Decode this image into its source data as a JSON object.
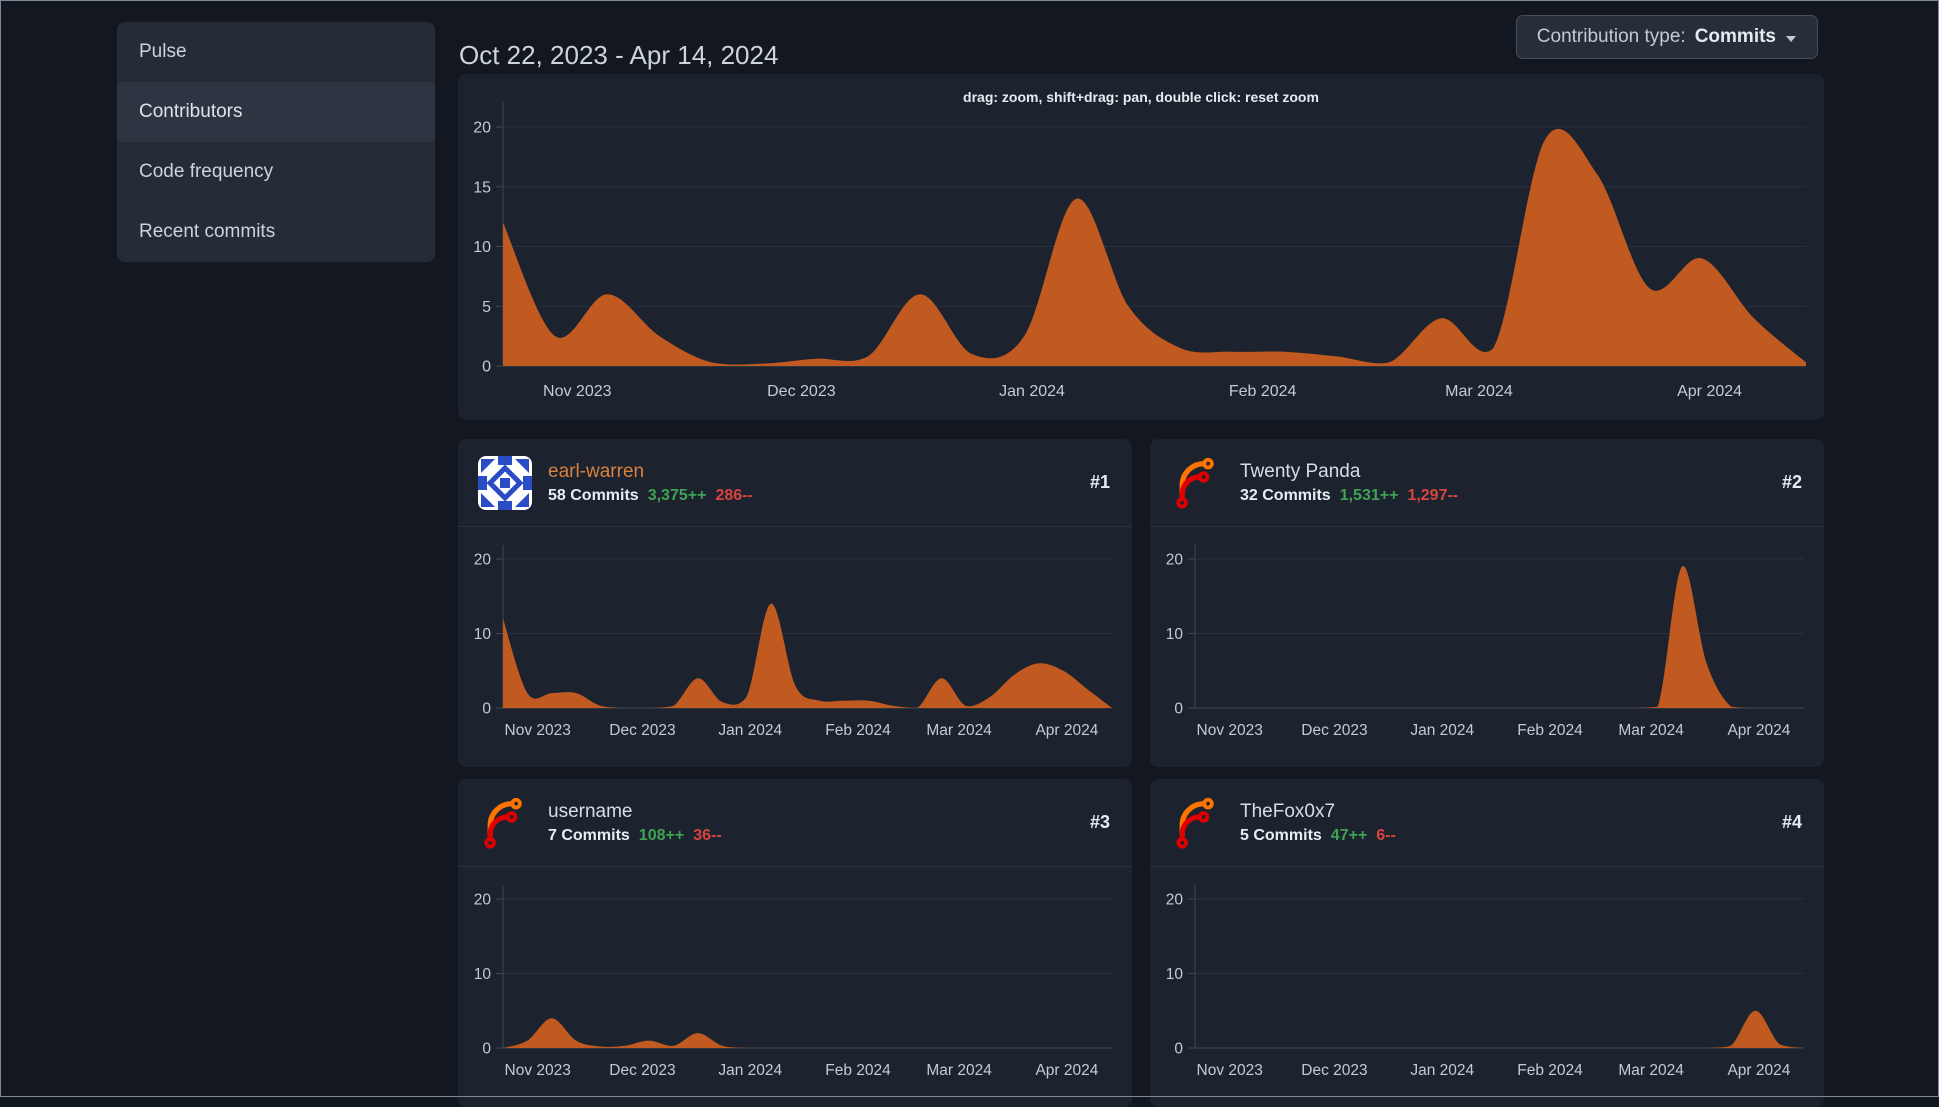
{
  "sidebar": {
    "items": [
      {
        "label": "Pulse",
        "active": false
      },
      {
        "label": "Contributors",
        "active": true
      },
      {
        "label": "Code frequency",
        "active": false
      },
      {
        "label": "Recent commits",
        "active": false
      }
    ]
  },
  "header": {
    "date_range": "Oct 22, 2023 - Apr 14, 2024",
    "contribution_type": {
      "label": "Contribution type:",
      "value": "Commits"
    }
  },
  "colors": {
    "area_orange": "#c05a20",
    "link_orange": "#d9813d",
    "additions_green": "#3fa255",
    "deletions_red": "#d8453f",
    "panel_background": "#1c232e",
    "page_background": "#13171f"
  },
  "contributors": [
    {
      "name": "earl-warren",
      "commits": "58 Commits",
      "additions": "3,375++",
      "deletions": "286--",
      "rank": "#1",
      "avatar": "identicon",
      "name_color": "orange"
    },
    {
      "name": "Twenty Panda",
      "commits": "32 Commits",
      "additions": "1,531++",
      "deletions": "1,297--",
      "rank": "#2",
      "avatar": "forgejo-logo",
      "name_color": "default"
    },
    {
      "name": "username",
      "commits": "7 Commits",
      "additions": "108++",
      "deletions": "36--",
      "rank": "#3",
      "avatar": "forgejo-logo",
      "name_color": "default"
    },
    {
      "name": "TheFox0x7",
      "commits": "5 Commits",
      "additions": "47++",
      "deletions": "6--",
      "rank": "#4",
      "avatar": "forgejo-logo",
      "name_color": "default"
    }
  ],
  "chart_data": [
    {
      "type": "area",
      "name": "all-contributions-weekly-commits",
      "hint": "drag: zoom, shift+drag: pan, double click: reset zoom",
      "x_range": [
        "Oct 22, 2023",
        "Apr 14, 2024"
      ],
      "interval": "weekly",
      "values": [
        12,
        2.5,
        6,
        2.5,
        0.3,
        0.2,
        0.6,
        0.8,
        6,
        1,
        2.5,
        14,
        5,
        1.5,
        1.2,
        1.2,
        0.8,
        0.3,
        4,
        1.5,
        19,
        16,
        6.5,
        9,
        4,
        0.3
      ],
      "ylim": [
        0,
        20
      ],
      "yticks": [
        0,
        5,
        10,
        15,
        20
      ],
      "xlabels": [
        "Nov 2023",
        "Dec 2023",
        "Jan 2024",
        "Feb 2024",
        "Mar 2024",
        "Apr 2024"
      ],
      "xlabel_fractions": [
        0.057,
        0.229,
        0.406,
        0.583,
        0.749,
        0.926
      ],
      "color": "#c05a20"
    },
    {
      "type": "area",
      "name": "earl-warren-weekly-commits",
      "x_range": [
        "Oct 22, 2023",
        "Apr 14, 2024"
      ],
      "interval": "weekly",
      "values": [
        12,
        2,
        2,
        2,
        0.3,
        0,
        0,
        0.3,
        4,
        0.8,
        1.5,
        14,
        3,
        1,
        1,
        1,
        0.3,
        0,
        4,
        0.3,
        1.5,
        4.5,
        6,
        5,
        2.5,
        0
      ],
      "ylim": [
        0,
        20
      ],
      "yticks": [
        0,
        10,
        20
      ],
      "xlabels": [
        "Nov 2023",
        "Dec 2023",
        "Jan 2024",
        "Feb 2024",
        "Mar 2024",
        "Apr 2024"
      ],
      "xlabel_fractions": [
        0.057,
        0.229,
        0.406,
        0.583,
        0.749,
        0.926
      ],
      "color": "#c05a20"
    },
    {
      "type": "area",
      "name": "twenty-panda-weekly-commits",
      "x_range": [
        "Oct 22, 2023",
        "Apr 14, 2024"
      ],
      "interval": "weekly",
      "values": [
        0,
        0,
        0,
        0,
        0,
        0,
        0,
        0,
        0,
        0,
        0,
        0,
        0,
        0,
        0,
        0,
        0,
        0,
        0,
        0.2,
        19,
        6,
        0.2,
        0,
        0,
        0
      ],
      "ylim": [
        0,
        20
      ],
      "yticks": [
        0,
        10,
        20
      ],
      "xlabels": [
        "Nov 2023",
        "Dec 2023",
        "Jan 2024",
        "Feb 2024",
        "Mar 2024",
        "Apr 2024"
      ],
      "xlabel_fractions": [
        0.057,
        0.229,
        0.406,
        0.583,
        0.749,
        0.926
      ],
      "color": "#c05a20"
    },
    {
      "type": "area",
      "name": "username-weekly-commits",
      "x_range": [
        "Oct 22, 2023",
        "Apr 14, 2024"
      ],
      "interval": "weekly",
      "values": [
        0,
        1,
        4,
        1,
        0.2,
        0.3,
        1,
        0.3,
        2,
        0.3,
        0,
        0,
        0,
        0,
        0,
        0,
        0,
        0,
        0,
        0,
        0,
        0,
        0,
        0,
        0,
        0
      ],
      "ylim": [
        0,
        20
      ],
      "yticks": [
        0,
        10,
        20
      ],
      "xlabels": [
        "Nov 2023",
        "Dec 2023",
        "Jan 2024",
        "Feb 2024",
        "Mar 2024",
        "Apr 2024"
      ],
      "xlabel_fractions": [
        0.057,
        0.229,
        0.406,
        0.583,
        0.749,
        0.926
      ],
      "color": "#c05a20"
    },
    {
      "type": "area",
      "name": "thefox0x7-weekly-commits",
      "x_range": [
        "Oct 22, 2023",
        "Apr 14, 2024"
      ],
      "interval": "weekly",
      "values": [
        0,
        0,
        0,
        0,
        0,
        0,
        0,
        0,
        0,
        0,
        0,
        0,
        0,
        0,
        0,
        0,
        0,
        0,
        0,
        0,
        0,
        0,
        0.3,
        5,
        0.5,
        0
      ],
      "ylim": [
        0,
        20
      ],
      "yticks": [
        0,
        10,
        20
      ],
      "xlabels": [
        "Nov 2023",
        "Dec 2023",
        "Jan 2024",
        "Feb 2024",
        "Mar 2024",
        "Apr 2024"
      ],
      "xlabel_fractions": [
        0.057,
        0.229,
        0.406,
        0.583,
        0.749,
        0.926
      ],
      "color": "#c05a20"
    }
  ]
}
